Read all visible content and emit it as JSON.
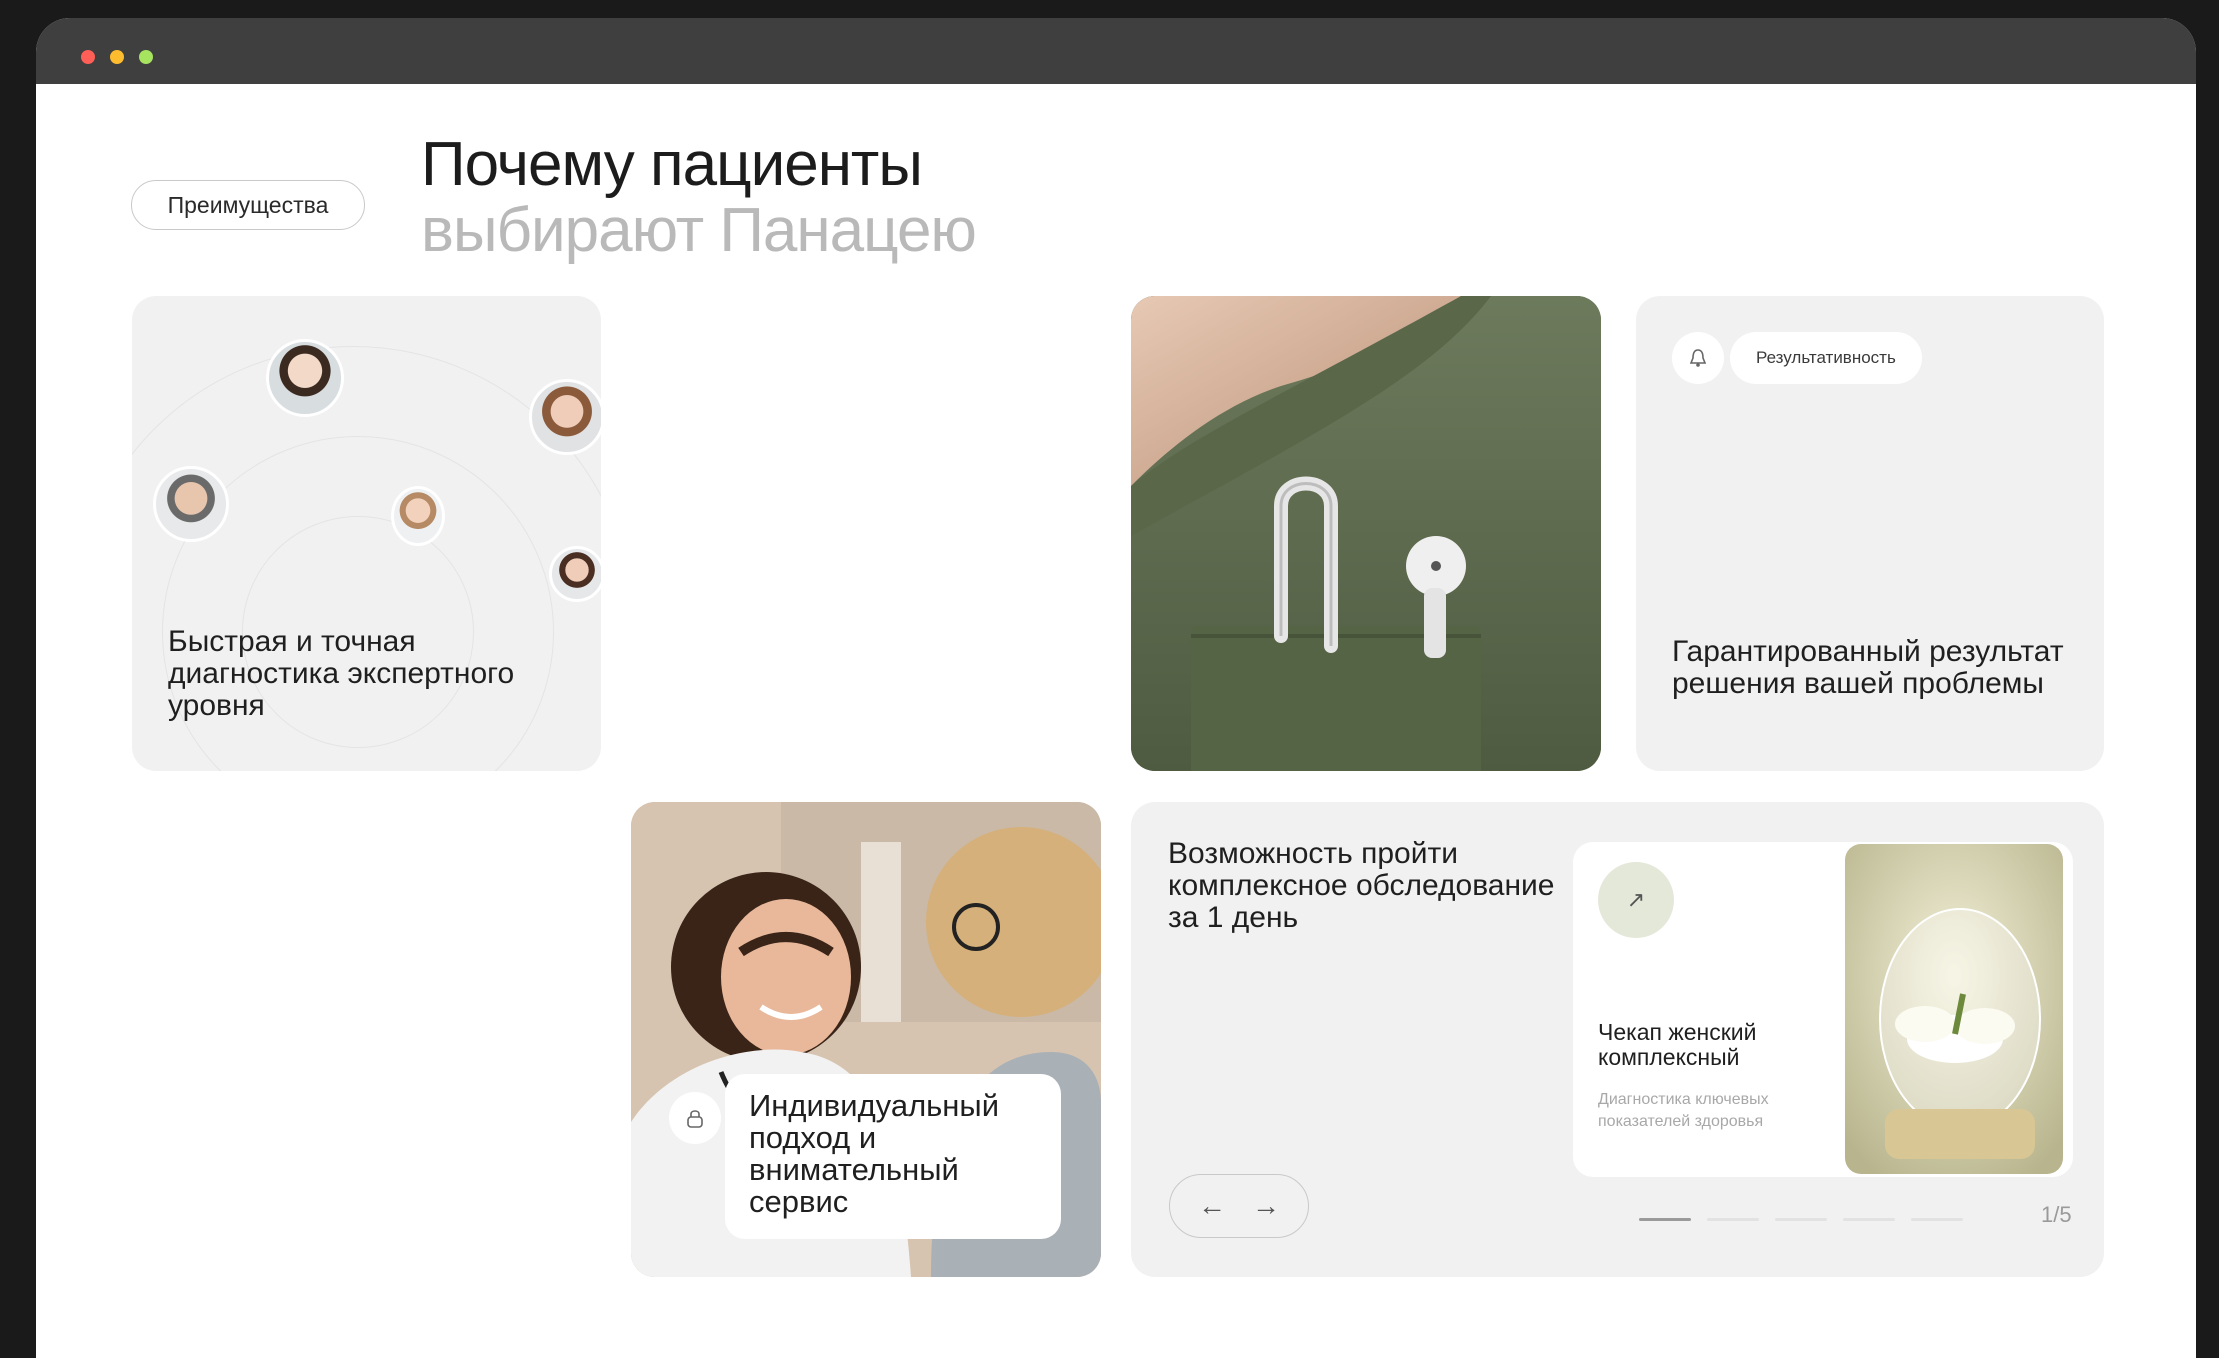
{
  "window": {
    "controls": [
      "close",
      "minimize",
      "maximize"
    ]
  },
  "section": {
    "badge": "Преимущества",
    "heading_line1": "Почему пациенты",
    "heading_line2": "выбирают Панацею"
  },
  "cards": {
    "diagnostics": {
      "title": "Быстрая и точная диагностика экспертного уровня"
    },
    "result": {
      "tag": "Результативность",
      "title": "Гарантированный результат решения вашей проблемы"
    },
    "individual": {
      "title": "Индивидуальный подход и внимательный сервис"
    },
    "checkup": {
      "title": "Возможность пройти комплексное обследование за 1 день",
      "item_name": "Чекап женский комплексный",
      "item_desc": "Диагностика ключевых показателей здоровья",
      "counter": "1/5",
      "prev_label": "←",
      "next_label": "→",
      "open_label": "↗",
      "total_slides": 5,
      "current_slide": 1
    }
  },
  "colors": {
    "accent_light": "#e4e8d9",
    "card_gray": "#f1f1f1",
    "muted_text": "#b9b9b9"
  }
}
